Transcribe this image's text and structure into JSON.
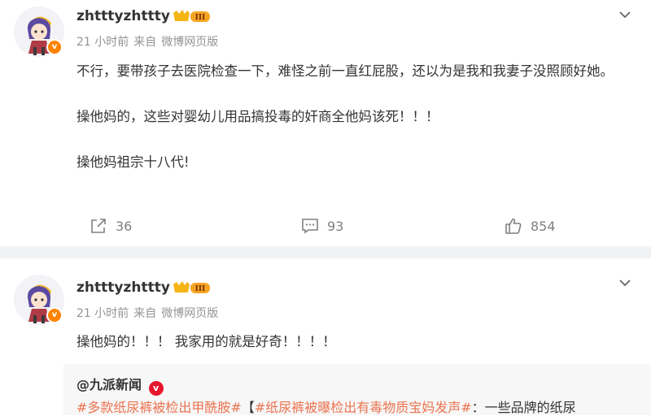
{
  "posts": [
    {
      "username": "zhtttyzhttty",
      "vip_level": "III",
      "time": "21 小时前",
      "source_prefix": "来自",
      "source": "微博网页版",
      "paragraphs": [
        "不行，要带孩子去医院检查一下，难怪之前一直红屁股，还以为是我和我妻子没照顾好她。",
        "操他妈的，这些对婴幼儿用品搞投毒的奸商全他妈该死！！！",
        "操他妈祖宗十八代!"
      ],
      "repost_count": "36",
      "comment_count": "93",
      "like_count": "854"
    },
    {
      "username": "zhtttyzhttty",
      "vip_level": "III",
      "time": "21 小时前",
      "source_prefix": "来自",
      "source": "微博网页版",
      "text": "操他妈的！！！ 我家用的就是好奇！！！！",
      "repost": {
        "author": "@九派新闻",
        "topic1": "#多款纸尿裤被检出甲酰胺#",
        "bracket_open": "【",
        "topic2": "#纸尿裤被曝检出有毒物质宝妈发声#",
        "snippet": "：一些品牌的纸尿"
      }
    }
  ],
  "icons": {
    "verified": "verified-badge-icon",
    "vip": "vip-crown-icon",
    "more": "chevron-down-icon",
    "repost": "repost-icon",
    "comment": "comment-icon",
    "like": "like-icon"
  },
  "colors": {
    "verified": "#ff8200",
    "topic": "#eb7350",
    "meta": "#939393",
    "divider": "#f1f2f5"
  }
}
